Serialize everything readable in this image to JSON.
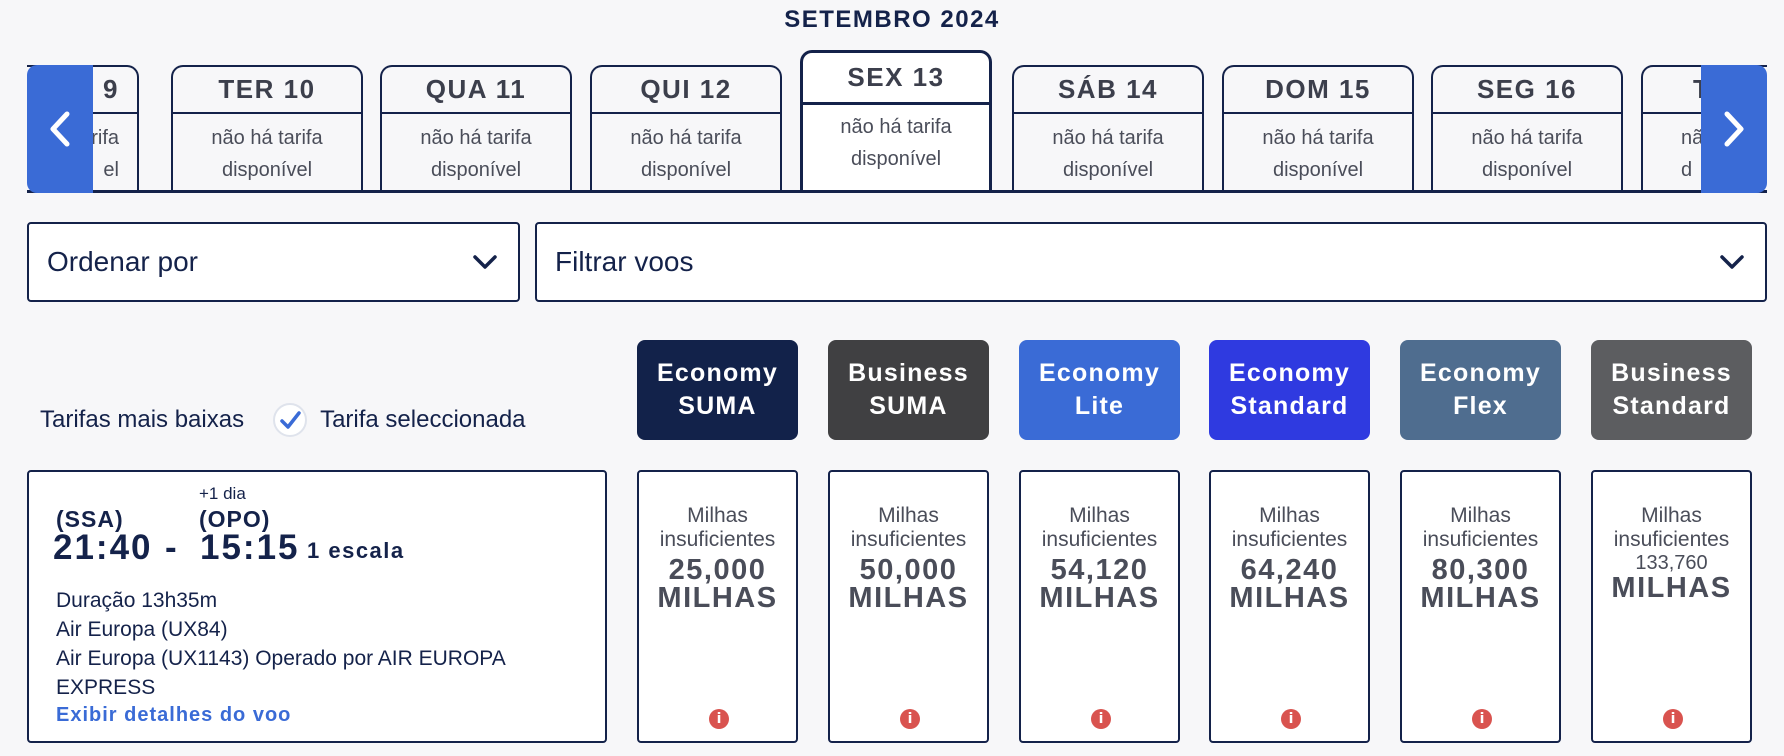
{
  "month_title": "SETEMBRO 2024",
  "date_tabs": [
    {
      "day": "9",
      "fare": [
        "tarifa",
        "el"
      ]
    },
    {
      "day": "TER 10",
      "fare": [
        "não há tarifa",
        "disponível"
      ]
    },
    {
      "day": "QUA 11",
      "fare": [
        "não há tarifa",
        "disponível"
      ]
    },
    {
      "day": "QUI 12",
      "fare": [
        "não há tarifa",
        "disponível"
      ]
    },
    {
      "day": "SEX 13",
      "fare": [
        "não há tarifa",
        "disponível"
      ],
      "selected": true
    },
    {
      "day": "SÁB 14",
      "fare": [
        "não há tarifa",
        "disponível"
      ]
    },
    {
      "day": "DOM 15",
      "fare": [
        "não há tarifa",
        "disponível"
      ]
    },
    {
      "day": "SEG 16",
      "fare": [
        "não há tarifa",
        "disponível"
      ]
    },
    {
      "day": "T",
      "fare": [
        "nã",
        "d"
      ]
    }
  ],
  "sort_dropdown": {
    "label": "Ordenar por"
  },
  "filter_dropdown": {
    "label": "Filtrar voos"
  },
  "legend": {
    "lowest": "Tarifas mais baixas",
    "selected": "Tarifa seleccionada"
  },
  "fare_families": [
    {
      "name": [
        "Economy",
        "SUMA"
      ],
      "color": "#12224a"
    },
    {
      "name": [
        "Business",
        "SUMA"
      ],
      "color": "#404042"
    },
    {
      "name": [
        "Economy",
        "Lite"
      ],
      "color": "#3a6bd6"
    },
    {
      "name": [
        "Economy",
        "Standard"
      ],
      "color": "#2f3ae0"
    },
    {
      "name": [
        "Economy",
        "Flex"
      ],
      "color": "#4f6d8f"
    },
    {
      "name": [
        "Business",
        "Standard"
      ],
      "color": "#5c5d60"
    }
  ],
  "flight": {
    "plus_day": "+1 dia",
    "origin_code": "(SSA)",
    "dest_code": "(OPO)",
    "departure": "21:40",
    "separator": "-",
    "arrival": "15:15",
    "stops": "1 escala",
    "duration": "Duração 13h35m",
    "segment1": "Air Europa (UX84)",
    "segment2": "Air Europa (UX1143) Operado por AIR EUROPA EXPRESS",
    "details_link": "Exibir detalhes do voo"
  },
  "prices": [
    {
      "message": "Milhas insuficientes",
      "amount": "25,000",
      "unit": "MILHAS"
    },
    {
      "message": "Milhas insuficientes",
      "amount": "50,000",
      "unit": "MILHAS"
    },
    {
      "message": "Milhas insuficientes",
      "amount": "54,120",
      "unit": "MILHAS"
    },
    {
      "message": "Milhas insuficientes",
      "amount": "64,240",
      "unit": "MILHAS"
    },
    {
      "message": "Milhas insuficientes",
      "amount": "80,300",
      "unit": "MILHAS"
    },
    {
      "message": "Milhas insuficientes",
      "amount": "133,760",
      "unit": "MILHAS"
    }
  ],
  "icons": {
    "prev": "chevron-left-icon",
    "next": "chevron-right-icon",
    "dropdown": "chevron-down-icon",
    "check": "check-icon",
    "info": "info-icon"
  },
  "colors": {
    "navy": "#14224a",
    "accent_blue": "#3a6bd6",
    "info_red": "#d9534f"
  }
}
